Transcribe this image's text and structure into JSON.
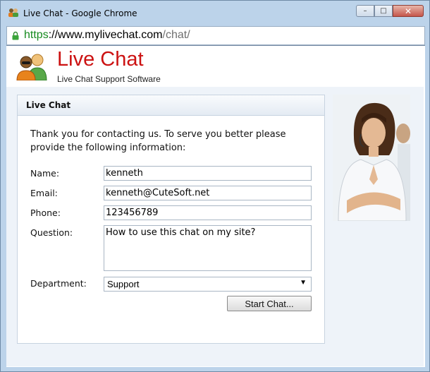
{
  "window": {
    "title": "Live Chat - Google Chrome",
    "minimize_label": "–",
    "maximize_label": "□",
    "close_label": "✕"
  },
  "address": {
    "scheme": "https",
    "host": "://www.mylivechat.com",
    "path": "/chat/"
  },
  "header": {
    "brand": "Live Chat",
    "tagline": "Live Chat Support Software"
  },
  "panel": {
    "title": "Live Chat",
    "intro": "Thank you for contacting us. To serve you better please provide the following information:"
  },
  "form": {
    "name_label": "Name:",
    "name_value": "kenneth",
    "email_label": "Email:",
    "email_value": "kenneth@CuteSoft.net",
    "phone_label": "Phone:",
    "phone_value": "123456789",
    "question_label": "Question:",
    "question_value": "How to use this chat on my site?",
    "department_label": "Department:",
    "department_value": "Support",
    "submit_label": "Start Chat..."
  },
  "colors": {
    "brand_red": "#cc1212",
    "url_green": "#168a1f"
  }
}
